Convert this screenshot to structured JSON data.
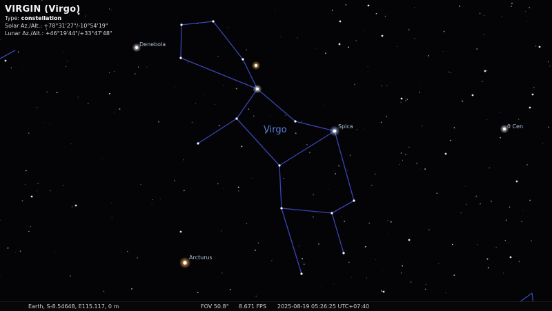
{
  "info": {
    "title": "VIRGIN (Virgo)",
    "type_label": "Type:",
    "type_value": "constellation",
    "solar": "Solar Az./Alt.: +78°31'27\"/-10°54'19\"",
    "lunar": "Lunar Az./Alt.: +46°19'44\"/+33°47'48\""
  },
  "labels": {
    "denebola": "Denebola",
    "spica": "Spica",
    "arcturus": "Arcturus",
    "theta_cen": "θ Cen"
  },
  "constellation": {
    "name": "Virgo",
    "line_color": "#3a46b8",
    "label_color": "#5b7ee0"
  },
  "status": {
    "location": "Earth, S-8.54648, E115.117, 0 m",
    "fov": "FOV 50.8°",
    "fps": "8.671 FPS",
    "datetime": "2025-08-19 05:26:25 UTC+07:40"
  }
}
